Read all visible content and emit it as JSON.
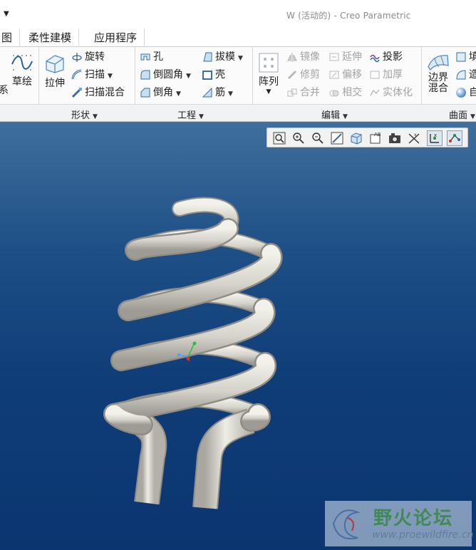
{
  "window": {
    "title": "W (活动的) - Creo Parametric"
  },
  "tabs": [
    {
      "label": "图"
    },
    {
      "label": "柔性建模"
    },
    {
      "label": "应用程序"
    }
  ],
  "ribbon": {
    "datum": {
      "partial_label": "系",
      "sketch_label": "草绘"
    },
    "shapes": {
      "extrude": "拉伸",
      "revolve": "旋转",
      "sweep": "扫描",
      "swept_blend": "扫描混合",
      "group_label": "形状"
    },
    "engineering": {
      "hole": "孔",
      "round": "倒圆角",
      "chamfer": "倒角",
      "draft": "拔模",
      "shell": "壳",
      "rib": "筋",
      "group_label": "工程"
    },
    "editing": {
      "pattern": "阵列",
      "mirror": "镜像",
      "trim": "修剪",
      "merge": "合并",
      "extend": "延伸",
      "offset": "偏移",
      "intersect": "相交",
      "project": "投影",
      "thicken": "加厚",
      "solidify": "实体化",
      "group_label": "编辑"
    },
    "surfaces": {
      "boundary_blend_line1": "边界",
      "boundary_blend_line2": "混合",
      "fill_partial": "填",
      "style_partial": "造",
      "free_partial": "自",
      "group_label": "曲面"
    }
  },
  "view_toolbar": {
    "icons": [
      "refit-icon",
      "zoom-in-icon",
      "zoom-out-icon",
      "repaint-icon",
      "display-style-icon",
      "saved-orientations-icon",
      "view-manager-icon",
      "datum-display-icon",
      "spin-center-icon",
      "annotation-display-icon"
    ]
  },
  "watermark": {
    "title": "野火论坛",
    "url": "www.proewildfire.cn"
  },
  "colors": {
    "accent": "#2a6db0",
    "model": "#d6d4cc",
    "background_top": "#3f6f9c",
    "background_bottom": "#0b3570"
  }
}
